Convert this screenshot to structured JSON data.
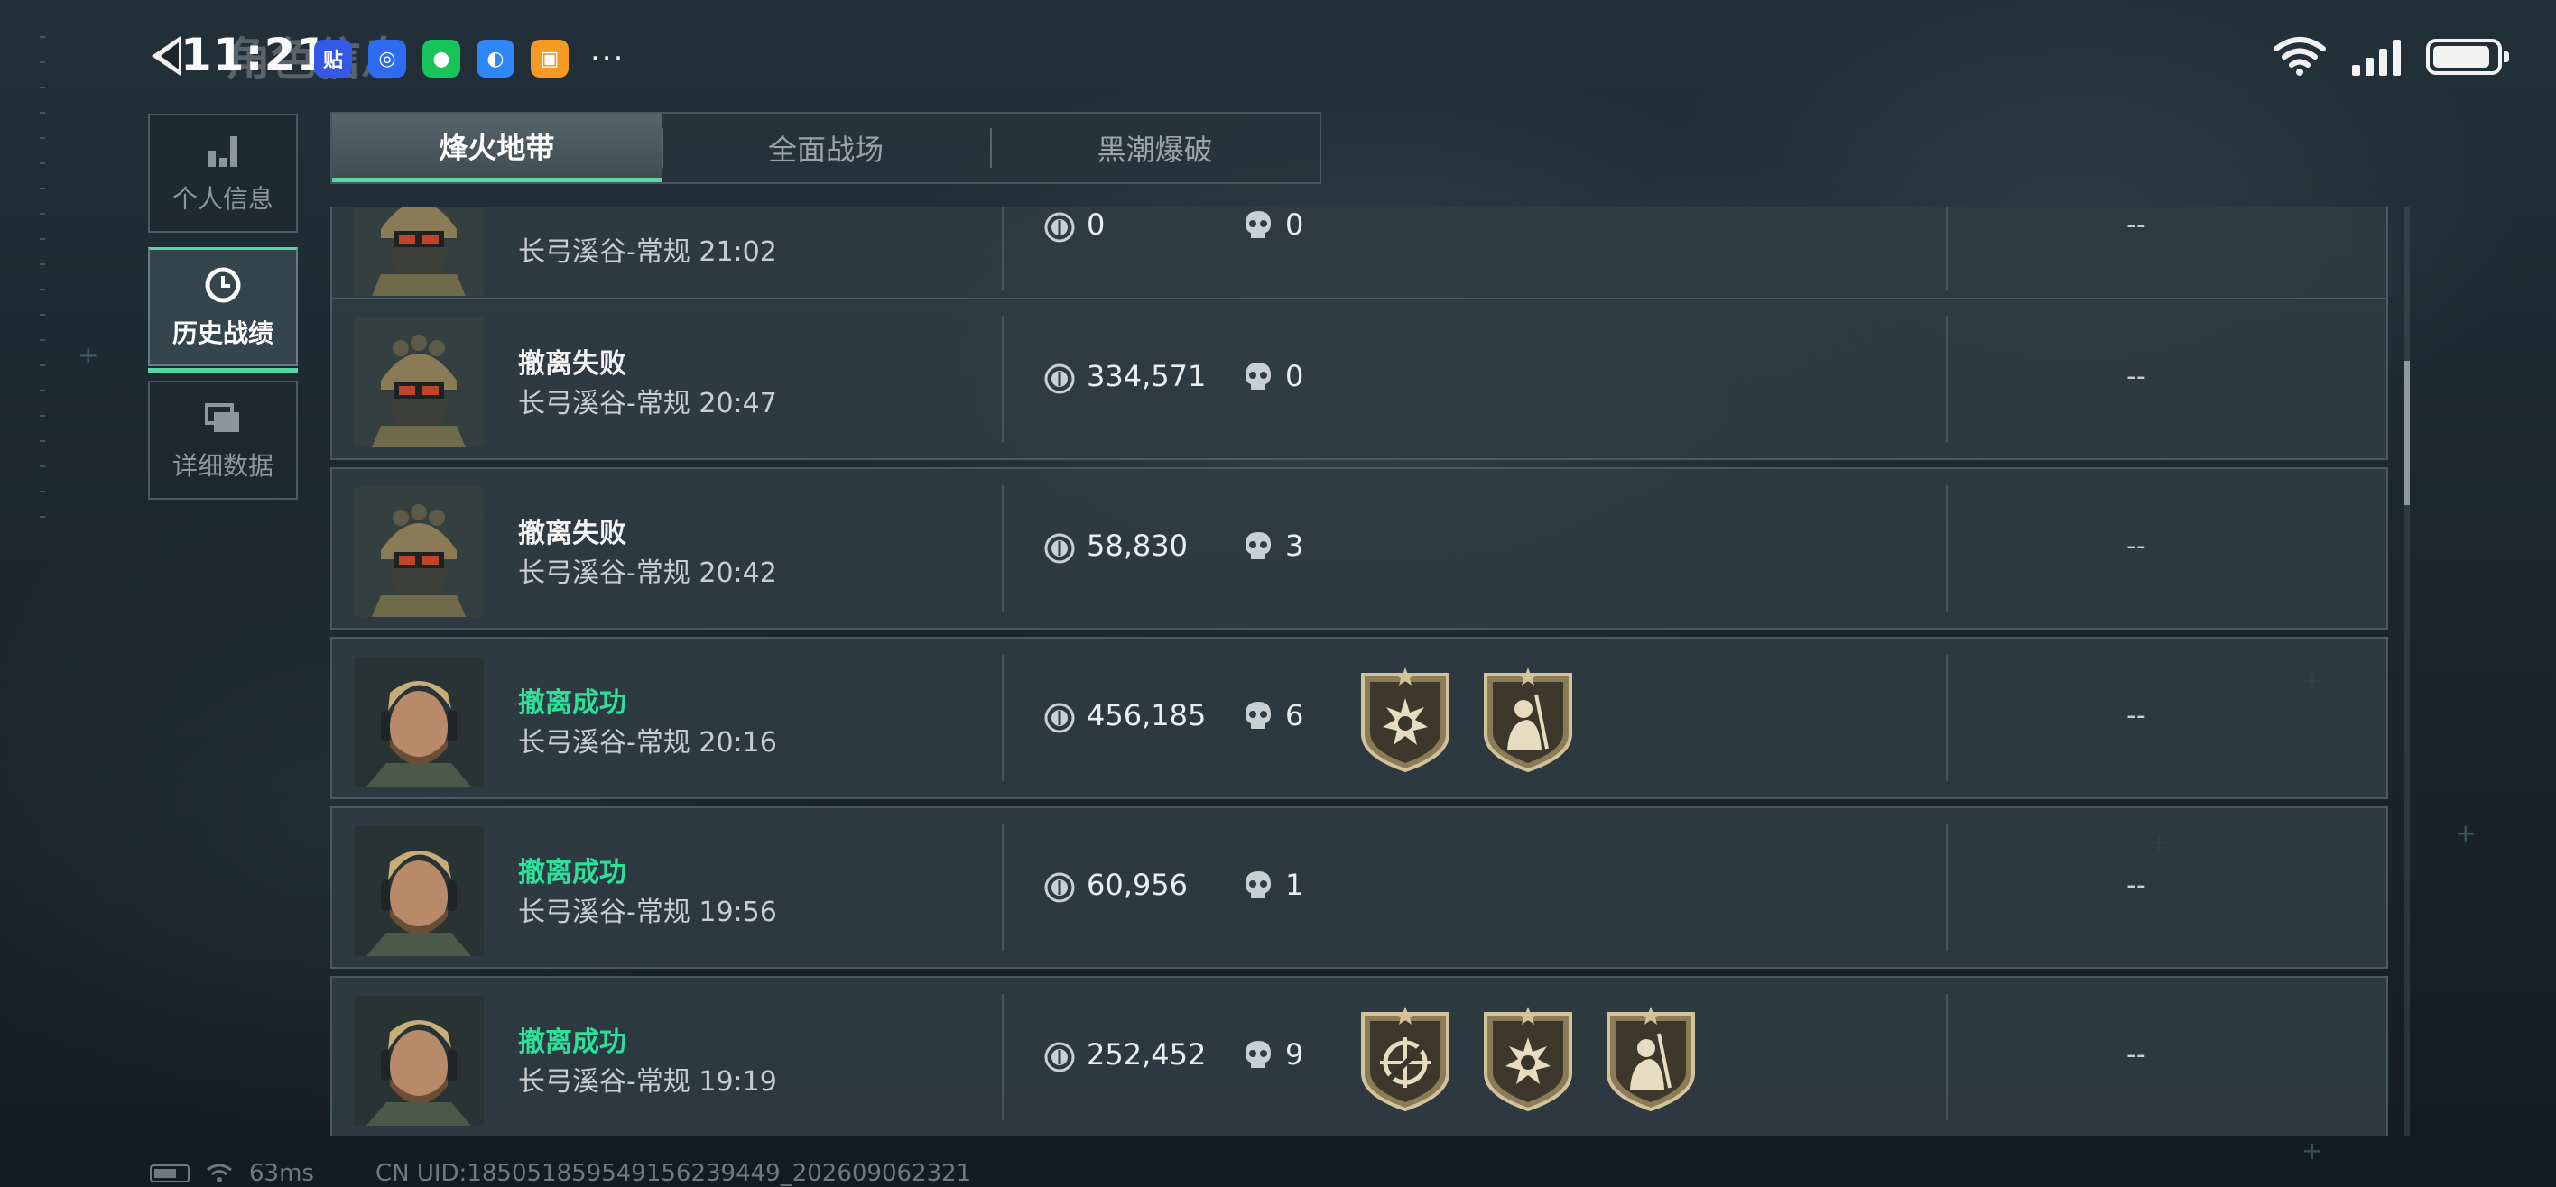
{
  "status_bar": {
    "time": "11:21",
    "ghost_title": "角色信息",
    "apps": [
      {
        "name": "tieba-app-icon",
        "glyph": "贴",
        "color": "#3558e6"
      },
      {
        "name": "browser-app-icon",
        "glyph": "◎",
        "color": "#2d6cf0"
      },
      {
        "name": "wechat-app-icon",
        "glyph": "●",
        "color": "#18c35a"
      },
      {
        "name": "bulb-app-icon",
        "glyph": "◐",
        "color": "#2f86f5"
      },
      {
        "name": "game-app-icon",
        "glyph": "▣",
        "color": "#f59a23"
      }
    ],
    "more": "···"
  },
  "sidebar": {
    "items": [
      {
        "label": "个人信息",
        "icon": "bar-chart-icon",
        "active": false
      },
      {
        "label": "历史战绩",
        "icon": "clock-icon",
        "active": true
      },
      {
        "label": "详细数据",
        "icon": "cards-icon",
        "active": false
      }
    ]
  },
  "tabs": [
    {
      "label": "烽火地带",
      "active": true
    },
    {
      "label": "全面战场",
      "active": false
    },
    {
      "label": "黑潮爆破",
      "active": false
    }
  ],
  "matches": [
    {
      "status": "",
      "status_type": "fail",
      "map": "长弓溪谷-常规 21:02",
      "value": "0",
      "kills": "0",
      "badges": [],
      "result": "--",
      "avatar": "military"
    },
    {
      "status": "撤离失败",
      "status_type": "fail",
      "map": "长弓溪谷-常规 20:47",
      "value": "334,571",
      "kills": "0",
      "badges": [],
      "result": "--",
      "avatar": "military"
    },
    {
      "status": "撤离失败",
      "status_type": "fail",
      "map": "长弓溪谷-常规 20:42",
      "value": "58,830",
      "kills": "3",
      "badges": [],
      "result": "--",
      "avatar": "military"
    },
    {
      "status": "撤离成功",
      "status_type": "success",
      "map": "长弓溪谷-常规 20:16",
      "value": "456,185",
      "kills": "6",
      "badges": [
        "burst-badge-icon",
        "soldier-badge-icon"
      ],
      "result": "--",
      "avatar": "blond"
    },
    {
      "status": "撤离成功",
      "status_type": "success",
      "map": "长弓溪谷-常规 19:56",
      "value": "60,956",
      "kills": "1",
      "badges": [],
      "result": "--",
      "avatar": "blond"
    },
    {
      "status": "撤离成功",
      "status_type": "success",
      "map": "长弓溪谷-常规 19:19",
      "value": "252,452",
      "kills": "9",
      "badges": [
        "crosshair-badge-icon",
        "burst-badge-icon",
        "soldier-badge-icon"
      ],
      "result": "--",
      "avatar": "blond"
    }
  ],
  "footer": {
    "ping": "63ms",
    "uid": "CN UID:185051859549156239449_202609062321"
  },
  "colors": {
    "accent": "#5ad6a5",
    "success": "#2fe09a",
    "badge_gold": "#b9a57a"
  }
}
